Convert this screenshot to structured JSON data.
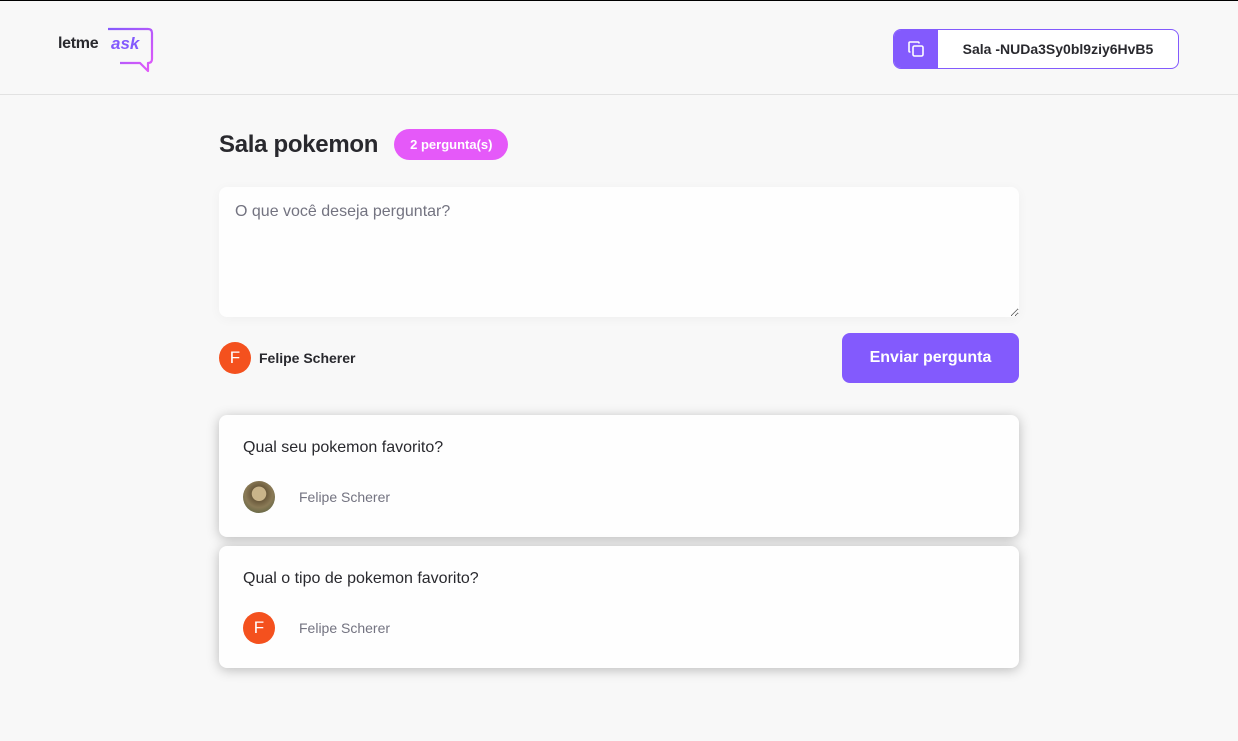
{
  "header": {
    "logo": {
      "part1": "letme",
      "part2": "ask"
    },
    "room_code": {
      "text": "Sala -NUDa3Sy0bl9ziy6HvB5",
      "icon": "copy-icon"
    }
  },
  "room": {
    "title": "Sala pokemon",
    "badge": "2 pergunta(s)"
  },
  "form": {
    "placeholder": "O que você deseja perguntar?",
    "value": "",
    "user": {
      "avatar_letter": "F",
      "name": "Felipe Scherer"
    },
    "send_label": "Enviar pergunta"
  },
  "questions": [
    {
      "content": "Qual seu pokemon favorito?",
      "author": "Felipe Scherer",
      "avatar": "photo"
    },
    {
      "content": "Qual o tipo de pokemon favorito?",
      "author": "Felipe Scherer",
      "avatar_letter": "F"
    }
  ],
  "colors": {
    "accent": "#835afd",
    "badge": "#e559f9",
    "avatar": "#f4511e",
    "background": "#f8f8f8"
  }
}
